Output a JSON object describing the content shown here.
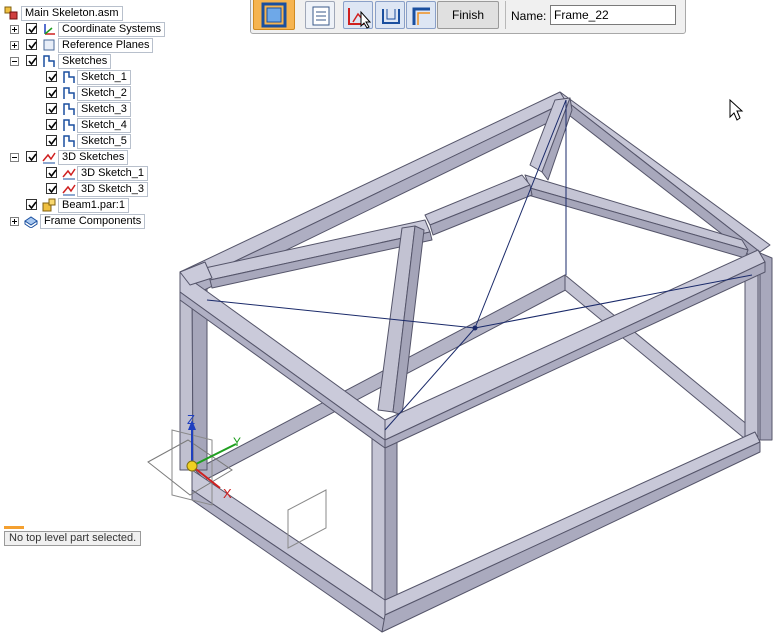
{
  "tree": {
    "root": {
      "label": "Main Skeleton.asm",
      "icon": "assembly-icon"
    },
    "items": [
      {
        "label": "Coordinate Systems",
        "icon": "coordinate-system-icon",
        "expander": "plus",
        "checked": true
      },
      {
        "label": "Reference Planes",
        "icon": "reference-plane-icon",
        "expander": "plus",
        "checked": true
      },
      {
        "label": "Sketches",
        "icon": "sketch-icon",
        "expander": "minus",
        "checked": true,
        "children": [
          "Sketch_1",
          "Sketch_2",
          "Sketch_3",
          "Sketch_4",
          "Sketch_5"
        ]
      },
      {
        "label": "3D Sketches",
        "icon": "3d-sketch-icon",
        "expander": "minus",
        "checked": true,
        "children": [
          "3D Sketch_1",
          "3D Sketch_3"
        ]
      },
      {
        "label": "Beam1.par:1",
        "icon": "part-icon",
        "checked": true
      },
      {
        "label": "Frame Components",
        "icon": "frame-components-icon",
        "expander": "plus"
      }
    ]
  },
  "command_bar": {
    "finish_label": "Finish",
    "name_label": "Name:",
    "name_value": "Frame_22",
    "buttons": [
      "frame-icon",
      "options-icon",
      "select-path-icon",
      "end-condition-icon",
      "miter-icon"
    ]
  },
  "status": {
    "message": "No top level part selected."
  },
  "axes": {
    "x": "X",
    "y": "Y",
    "z": "Z"
  },
  "colors": {
    "accent": "#f6b450",
    "beam_face": "#c8c8d8",
    "beam_edge": "#5a5a6e",
    "sketch_line": "#1a2a6a"
  }
}
